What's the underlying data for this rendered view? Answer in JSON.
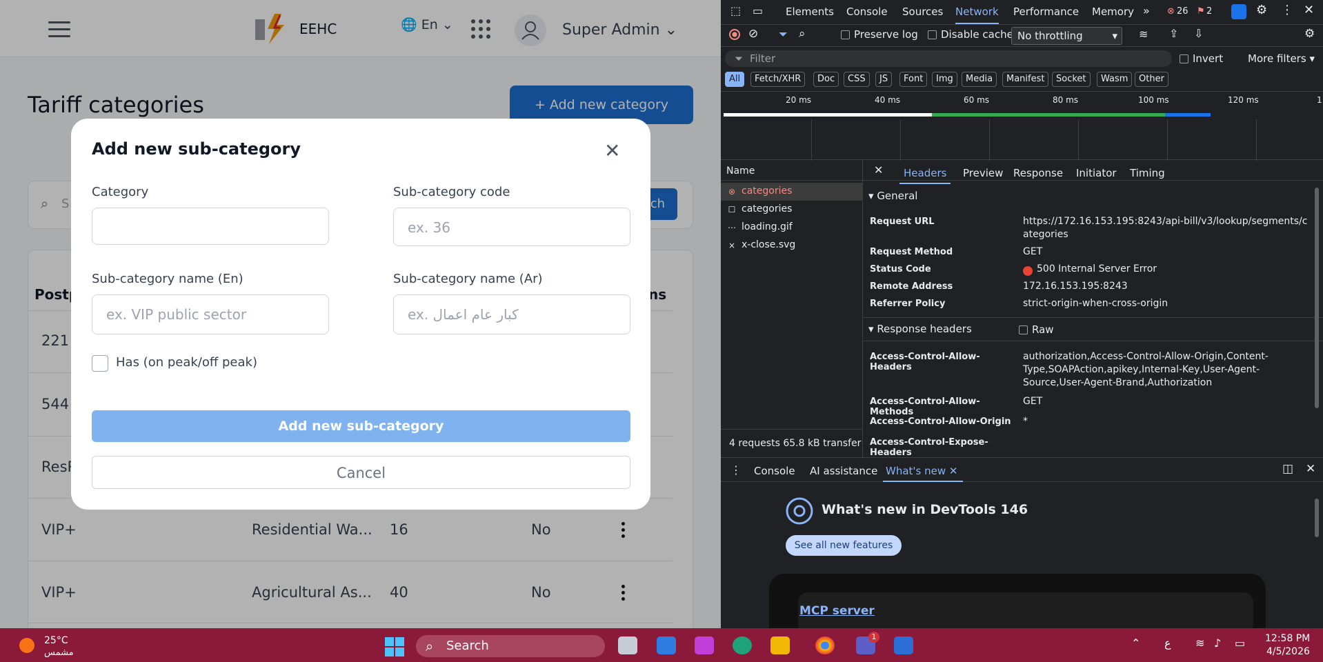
{
  "app": {
    "brand": "EEHC",
    "language": "En",
    "user": "Super Admin",
    "page_title": "Tariff categories",
    "add_category_label": "+ Add new category",
    "search_button": "ch",
    "search_placeholder": "S",
    "table": {
      "headers": [
        "Postp",
        "ns"
      ],
      "rows": [
        {
          "c1": "221"
        },
        {
          "c1": "544"
        },
        {
          "c1": "ResR"
        },
        {
          "c1": "VIP+",
          "c2": "Residential Wa...",
          "c3": "16",
          "c4": "No"
        },
        {
          "c1": "VIP+",
          "c2": "Agricultural As...",
          "c3": "40",
          "c4": "No"
        }
      ]
    }
  },
  "modal": {
    "title": "Add new sub-category",
    "category_label": "Category",
    "category_value": "",
    "code_label": "Sub-category code",
    "code_placeholder": "ex. 36",
    "name_en_label": "Sub-category name (En)",
    "name_en_placeholder": "ex. VIP public sector",
    "name_ar_label": "Sub-category name (Ar)",
    "name_ar_placeholder": "ex. كبار عام اعمال",
    "peak_label": "Has (on peak/off peak)",
    "submit_label": "Add new sub-category",
    "cancel_label": "Cancel"
  },
  "devtools": {
    "tabs": [
      "Elements",
      "Console",
      "Sources",
      "Network",
      "Performance",
      "Memory"
    ],
    "errors": "26",
    "warnings": "2",
    "preserve_log": "Preserve log",
    "disable_cache": "Disable cache",
    "throttling": "No throttling",
    "filter_placeholder": "Filter",
    "invert": "Invert",
    "more_filters": "More filters",
    "type_filters": [
      "All",
      "Fetch/XHR",
      "Doc",
      "CSS",
      "JS",
      "Font",
      "Img",
      "Media",
      "Manifest",
      "Socket",
      "Wasm",
      "Other"
    ],
    "timeline_ticks": [
      "20 ms",
      "40 ms",
      "60 ms",
      "80 ms",
      "100 ms",
      "120 ms",
      "1"
    ],
    "name_header": "Name",
    "requests": [
      "categories",
      "categories",
      "loading.gif",
      "x-close.svg"
    ],
    "summary": "4 requests   65.8 kB transfer",
    "detail_tabs": [
      "Headers",
      "Preview",
      "Response",
      "Initiator",
      "Timing"
    ],
    "general_title": "General",
    "general": [
      {
        "k": "Request URL",
        "v": "https://172.16.153.195:8243/api-bill/v3/lookup/segments/categories"
      },
      {
        "k": "Request Method",
        "v": "GET"
      },
      {
        "k": "Status Code",
        "v": "500 Internal Server Error"
      },
      {
        "k": "Remote Address",
        "v": "172.16.153.195:8243"
      },
      {
        "k": "Referrer Policy",
        "v": "strict-origin-when-cross-origin"
      }
    ],
    "response_headers_title": "Response headers",
    "raw_label": "Raw",
    "response_headers": [
      {
        "k": "Access-Control-Allow-Headers",
        "v": "authorization,Access-Control-Allow-Origin,Content-Type,SOAPAction,apikey,Internal-Key,User-Agent-Source,User-Agent-Brand,Authorization"
      },
      {
        "k": "Access-Control-Allow-Methods",
        "v": "GET"
      },
      {
        "k": "Access-Control-Allow-Origin",
        "v": "*"
      },
      {
        "k": "Access-Control-Expose-Headers",
        "v": ""
      }
    ],
    "drawer_tabs": [
      "Console",
      "AI assistance",
      "What's new"
    ],
    "whats_new_title": "What's new in DevTools 146",
    "see_all": "See all new features",
    "mcp_link": "MCP server"
  },
  "taskbar": {
    "temp": "25°C",
    "weather": "مشمس",
    "search": "Search",
    "lang_indicator": "ع",
    "time": "12:58 PM",
    "date": "4/5/2026",
    "teams_badge": "1"
  }
}
